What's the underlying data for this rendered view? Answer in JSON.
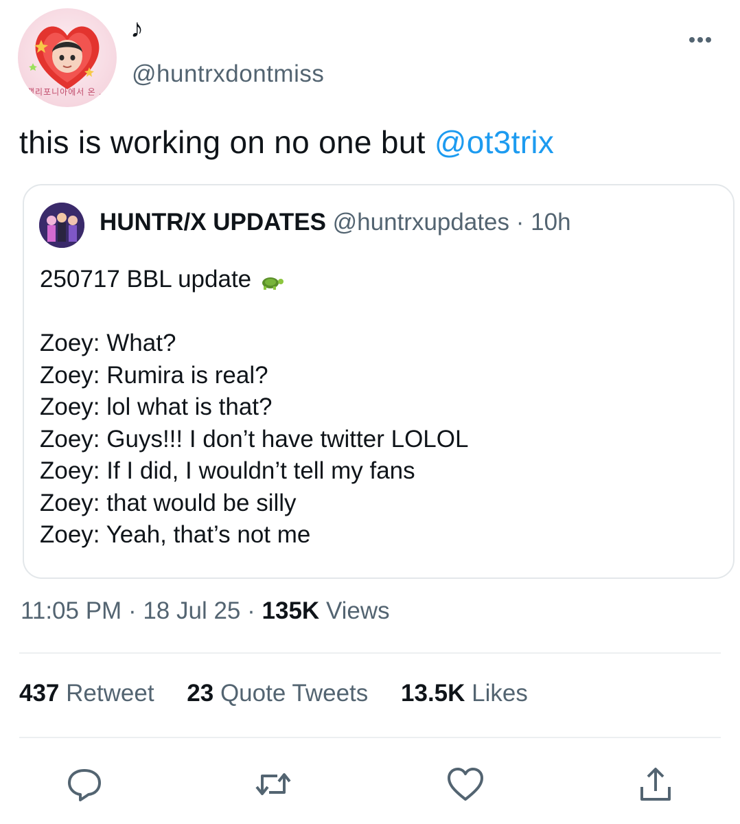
{
  "author": {
    "display_name": "♪",
    "handle": "@huntrxdontmiss",
    "avatar_caption": "캘리포니아에서 온 ..."
  },
  "tweet": {
    "text": "this is working on no one but ",
    "mention": "@ot3trix"
  },
  "quoted_tweet": {
    "name": "HUNTR/X UPDATES",
    "handle": "@huntrxupdates",
    "separator": "·",
    "time": "10h",
    "first_line": "250717 BBL update",
    "emoji_icon": "turtle-icon",
    "lines": [
      "Zoey: What?",
      "Zoey: Rumira is real?",
      "Zoey: lol what is that?",
      "Zoey: Guys!!! I don’t have twitter LOLOL",
      "Zoey: If I did, I wouldn’t tell my fans",
      "Zoey: that would be silly",
      "Zoey: Yeah, that’s not me"
    ]
  },
  "meta": {
    "time": "11:05 PM",
    "separator": "·",
    "date": "18 Jul 25",
    "views_count": "135K",
    "views_label": "Views"
  },
  "stats": {
    "retweets_count": "437",
    "retweets_label": "Retweet",
    "quotes_count": "23",
    "quotes_label": "Quote Tweets",
    "likes_count": "13.5K",
    "likes_label": "Likes"
  },
  "actions": [
    "reply-icon",
    "retweet-icon",
    "like-icon",
    "share-icon"
  ],
  "colors": {
    "link": "#1d9bf0",
    "secondary_text": "#536471",
    "primary_text": "#0f1419",
    "border": "#e3e7ea"
  }
}
